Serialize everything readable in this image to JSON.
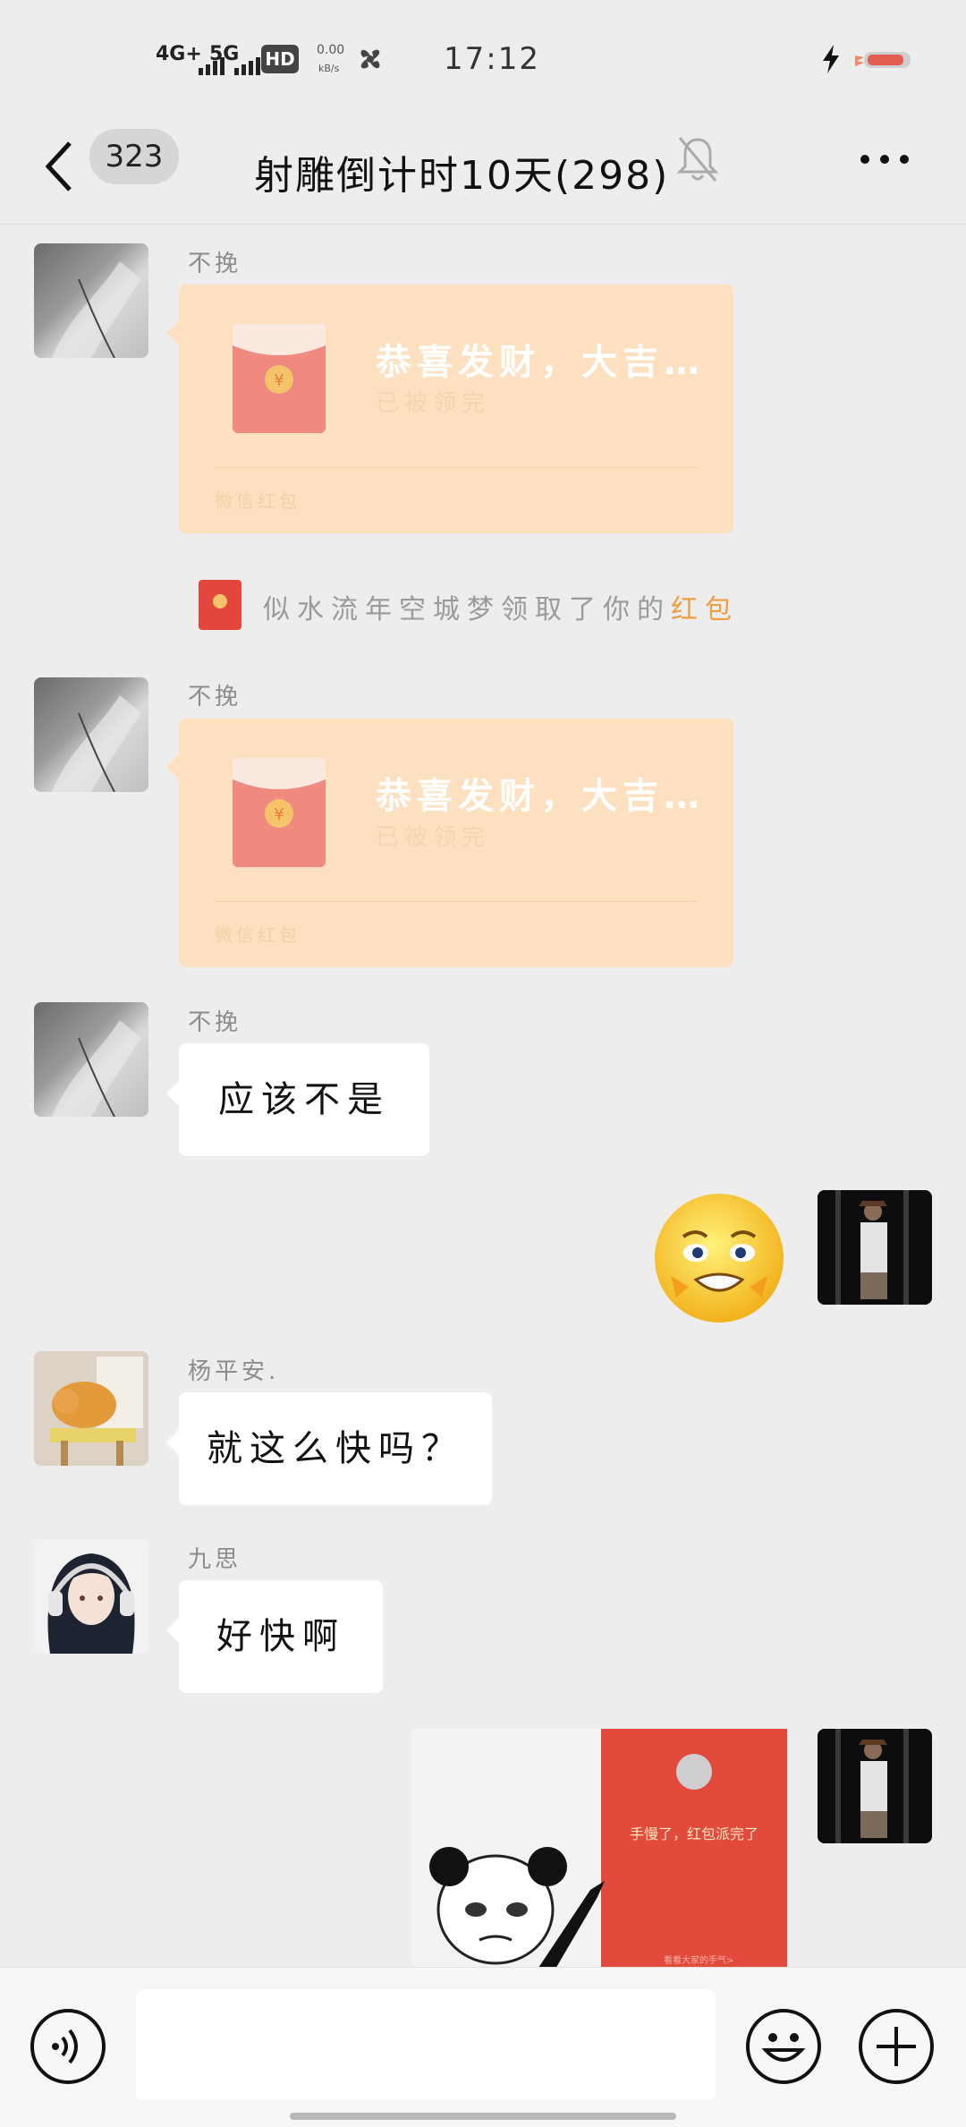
{
  "status_bar": {
    "network_1": "4G+",
    "network_2": "5G",
    "hd_label": "HD",
    "speed_value": "0.00",
    "speed_unit": "kB/s",
    "time": "17:12"
  },
  "header": {
    "unread_count": "323",
    "title": "射雕倒计时10天(298)"
  },
  "messages": [
    {
      "sender": "不挽",
      "type": "red_packet",
      "title": "恭喜发财，大吉…",
      "status": "已被领完",
      "footer": "微信红包"
    },
    {
      "type": "system",
      "prefix": "似水流年空城梦领取了你的",
      "highlight": "红包"
    },
    {
      "sender": "不挽",
      "type": "red_packet",
      "title": "恭喜发财，大吉…",
      "status": "已被领完",
      "footer": "微信红包"
    },
    {
      "sender": "不挽",
      "type": "text",
      "text": "应该不是"
    },
    {
      "type": "self_sticker"
    },
    {
      "sender": "杨平安.",
      "type": "text",
      "text": "就这么快吗？"
    },
    {
      "sender": "九思",
      "type": "text",
      "text": "好快啊"
    },
    {
      "type": "self_image",
      "caption": "手慢了，红包派完了",
      "small_text": "看看大家的手气>"
    }
  ],
  "input_bar": {
    "voice_icon": "voice-icon",
    "emoji_icon": "emoji-icon",
    "plus_icon": "plus-icon"
  },
  "colors": {
    "background": "#ededed",
    "red_packet": "#fde0bf",
    "highlight": "#f29c40"
  }
}
